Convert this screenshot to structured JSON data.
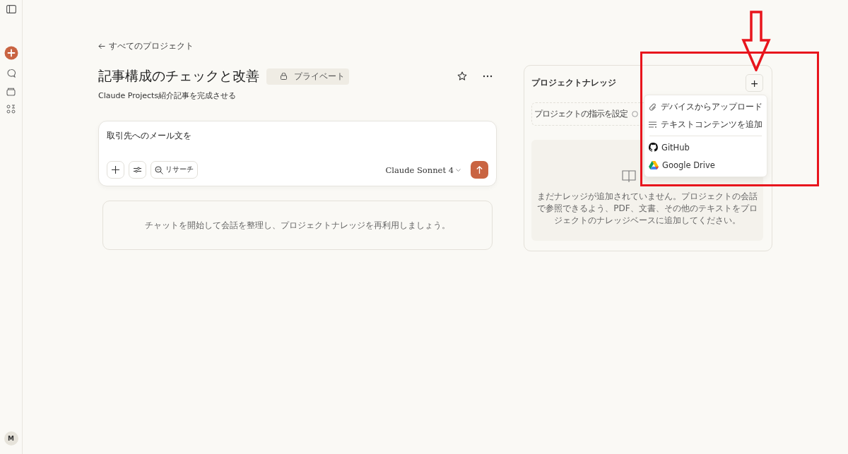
{
  "sidebar": {
    "avatar": "M"
  },
  "back_link": "すべてのプロジェクト",
  "project": {
    "title": "記事構成のチェックと改善",
    "badge": "プライベート",
    "description": "Claude Projects紹介記事を完成させる"
  },
  "composer": {
    "value": "取引先へのメール文を",
    "research_label": "リサーチ",
    "model": "Claude Sonnet 4"
  },
  "chat_empty": "チャットを開始して会話を整理し、プロジェクトナレッジを再利用しましょう。",
  "knowledge": {
    "title": "プロジェクトナレッジ",
    "add_button": "+",
    "instructions": "プロジェクトの指示を設定",
    "empty_text": "まだナレッジが追加されていません。プロジェクトの会話で参照できるよう、PDF、文書、その他のテキストをプロジェクトのナレッジベースに追加してください。"
  },
  "menu_groups": [
    [
      {
        "kind": "upload",
        "label": "デバイスからアップロード"
      },
      {
        "kind": "text",
        "label": "テキストコンテンツを追加"
      }
    ],
    [
      {
        "kind": "github",
        "label": "GitHub"
      },
      {
        "kind": "drive",
        "label": "Google Drive"
      }
    ]
  ]
}
